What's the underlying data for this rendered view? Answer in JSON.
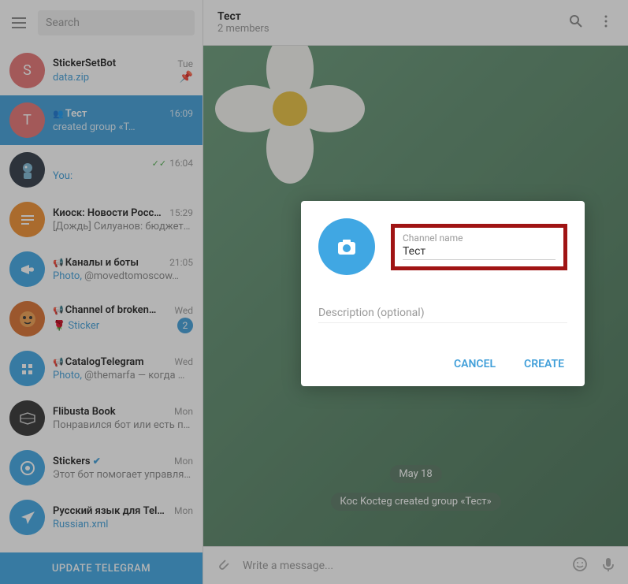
{
  "search": {
    "placeholder": "Search"
  },
  "update_label": "UPDATE TELEGRAM",
  "header": {
    "title": "Тест",
    "subtitle": "2 members"
  },
  "chat_bg": {
    "date": "May 18",
    "system_message": "Кос Koctеg created group «Тест»"
  },
  "composer": {
    "placeholder": "Write a message..."
  },
  "modal": {
    "channel_name_label": "Channel name",
    "channel_name_value": "Тест",
    "description_placeholder": "Description (optional)",
    "cancel": "CANCEL",
    "create": "CREATE"
  },
  "chats": [
    {
      "letter": "S",
      "color": "#e57373",
      "title": "StickerSetBot",
      "time": "Tue",
      "preview_link": "data.zip",
      "pinned": true
    },
    {
      "letter": "Т",
      "color": "#e57373",
      "title": "Тест",
      "time": "16:09",
      "preview": "  created group «Т…",
      "group_icon": true,
      "selected": true
    },
    {
      "avatar": "robot",
      "title": "",
      "time": "16:04",
      "read": true,
      "you": "You:"
    },
    {
      "avatar": "kiosk",
      "title": "Киоск: Новости Росс…",
      "time": "15:29",
      "preview": "[Дождь]  Силуанов: бюджет…"
    },
    {
      "avatar": "megaphone",
      "title": "Каналы и боты",
      "time": "21:05",
      "channel": true,
      "preview_link": "Photo,",
      "preview": " @movedtomoscow…"
    },
    {
      "avatar": "tiger",
      "title": "Channel of broken…",
      "time": "Wed",
      "channel": true,
      "preview_link": "Sticker",
      "rose": true,
      "badge": "2"
    },
    {
      "avatar": "catalog",
      "title": "CatalogTelegram",
      "time": "Wed",
      "channel": true,
      "preview_link": "Photo,",
      "preview": " @themarfa — когда …"
    },
    {
      "avatar": "books",
      "title": "Flibusta Book",
      "time": "Mon",
      "preview": "Понравился бот или есть п…"
    },
    {
      "avatar": "stickers",
      "title": "Stickers",
      "time": "Mon",
      "verified": true,
      "preview": "Этот бот помогает управля…"
    },
    {
      "avatar": "paper",
      "title": "Русский язык для Tel…",
      "time": "Mon",
      "preview_link": "Russian.xml"
    }
  ]
}
